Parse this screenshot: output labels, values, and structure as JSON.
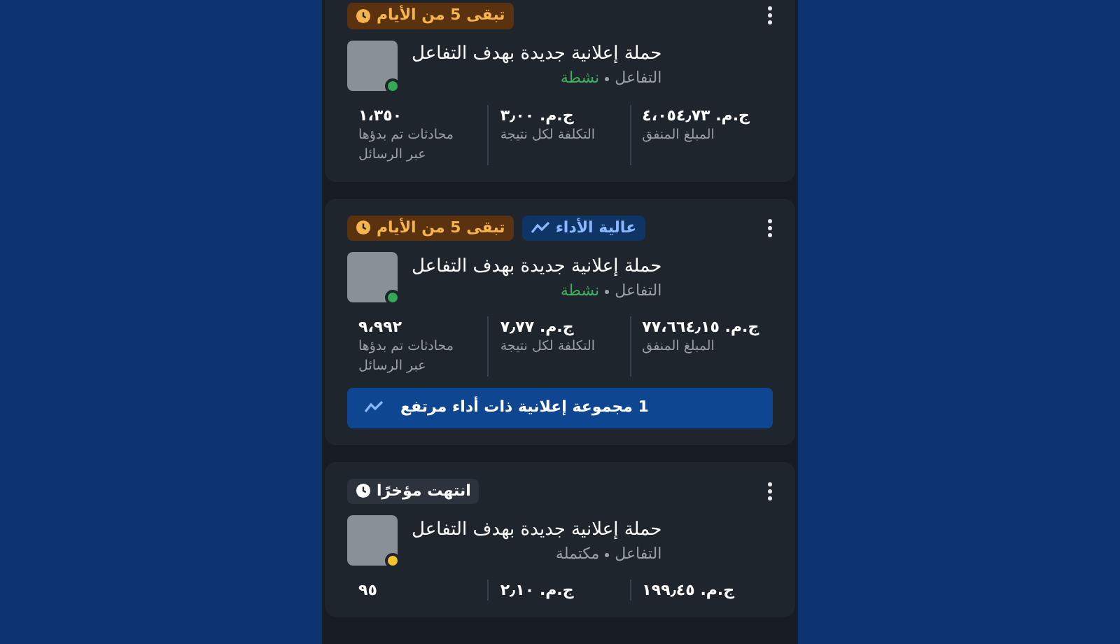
{
  "campaigns": [
    {
      "badges": [
        {
          "kind": "time_left",
          "text": "تبقى 5 من الأيام"
        }
      ],
      "title": "حملة إعلانية جديدة بهدف التفاعل",
      "objective": "التفاعل",
      "status": {
        "text": "نشطة",
        "kind": "active",
        "color": "#34a853"
      },
      "metrics": [
        {
          "value": "ج.م. ٤،٠٥٤٫٧٣",
          "label": "المبلغ المنفق"
        },
        {
          "value": "ج.م. ٣٫٠٠",
          "label": "التكلفة لكل نتيجة"
        },
        {
          "value": "١،٣٥٠",
          "label": "محادثات تم بدؤها عبر الرسائل"
        }
      ]
    },
    {
      "badges": [
        {
          "kind": "high_performance",
          "text": "عالية الأداء"
        },
        {
          "kind": "time_left",
          "text": "تبقى 5 من الأيام"
        }
      ],
      "title": "حملة إعلانية جديدة بهدف التفاعل",
      "objective": "التفاعل",
      "status": {
        "text": "نشطة",
        "kind": "active",
        "color": "#34a853"
      },
      "metrics": [
        {
          "value": "ج.م. ٧٧،٦٦٤٫١٥",
          "label": "المبلغ المنفق"
        },
        {
          "value": "ج.م. ٧٫٧٧",
          "label": "التكلفة لكل نتيجة"
        },
        {
          "value": "٩،٩٩٢",
          "label": "محادثات تم بدؤها عبر الرسائل"
        }
      ],
      "banner": "1 مجموعة إعلانية ذات أداء مرتفع"
    },
    {
      "badges": [
        {
          "kind": "ended",
          "text": "انتهت مؤخرًا"
        }
      ],
      "title": "حملة إعلانية جديدة بهدف التفاعل",
      "objective": "التفاعل",
      "status": {
        "text": "مكتملة",
        "kind": "completed",
        "color": "#f4c430"
      },
      "metrics": [
        {
          "value": "ج.م. ١٩٩٫٤٥"
        },
        {
          "value": "ج.م. ٢٫١٠"
        },
        {
          "value": "٩٥"
        }
      ]
    }
  ]
}
